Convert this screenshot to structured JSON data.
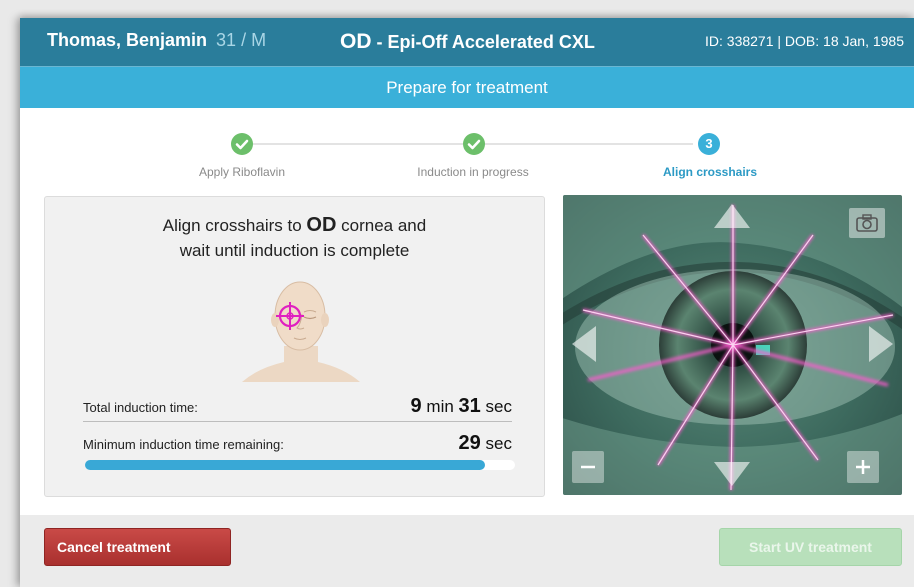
{
  "header": {
    "patient_name": "Thomas, Benjamin",
    "patient_age_sex": "31 / M",
    "eye": "OD",
    "procedure": " - Epi-Off Accelerated CXL",
    "patient_id_dob": "ID: 338271 | DOB: 18 Jan, 1985"
  },
  "subheader": {
    "title": "Prepare for treatment"
  },
  "steps": [
    {
      "number": "1",
      "label": "Apply Riboflavin",
      "status": "done"
    },
    {
      "number": "2",
      "label": "Induction in progress",
      "status": "done"
    },
    {
      "number": "3",
      "label": "Align crosshairs",
      "status": "current"
    }
  ],
  "instruction": {
    "line1_pre": "Align crosshairs to ",
    "line1_eye": "OD",
    "line1_post": " cornea and",
    "line2": "wait until induction is complete"
  },
  "timing": {
    "total_label": "Total induction time:",
    "total_min": "9",
    "min_unit": "min",
    "total_sec": "31",
    "sec_unit": "sec",
    "remaining_label": "Minimum induction time remaining:",
    "remaining_sec": "29",
    "remaining_unit": "sec",
    "progress_fraction": 0.93
  },
  "camera": {
    "icons": [
      "camera-icon",
      "arrow-up-icon",
      "arrow-down-icon",
      "arrow-left-icon",
      "arrow-right-icon",
      "zoom-out-icon",
      "zoom-in-icon"
    ],
    "zoom_out_label": "−",
    "zoom_in_label": "+"
  },
  "footer": {
    "cancel_label": "Cancel treatment",
    "start_label": "Start UV treatment"
  },
  "colors": {
    "header_bg": "#2a7d9b",
    "subheader_bg": "#3ab0d9",
    "step_done": "#6cbf6a",
    "step_current": "#3ab0d9",
    "progress_fill": "#39a8d6",
    "cancel_button": "#b53a38",
    "start_button_disabled": "#b8e0bb",
    "crosshair": "#e020c0"
  }
}
